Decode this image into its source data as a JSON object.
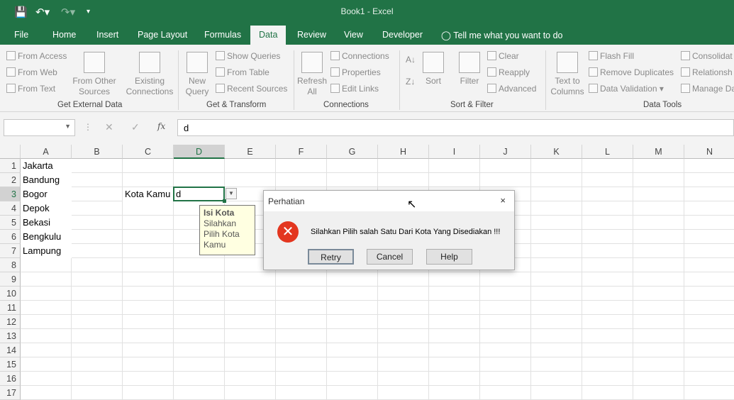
{
  "window": {
    "title": "Book1  -  Excel"
  },
  "tabs": [
    "File",
    "Home",
    "Insert",
    "Page Layout",
    "Formulas",
    "Data",
    "Review",
    "View",
    "Developer"
  ],
  "tell_me": "Tell me what you want to do",
  "ribbon": {
    "get_external": {
      "label": "Get External Data",
      "from_access": "From Access",
      "from_web": "From Web",
      "from_text": "From Text",
      "from_other_1": "From Other",
      "from_other_2": "Sources",
      "existing_1": "Existing",
      "existing_2": "Connections"
    },
    "get_transform": {
      "label": "Get & Transform",
      "new_1": "New",
      "new_2": "Query",
      "show_queries": "Show Queries",
      "from_table": "From Table",
      "recent_sources": "Recent Sources"
    },
    "connections": {
      "label": "Connections",
      "refresh_1": "Refresh",
      "refresh_2": "All",
      "connections": "Connections",
      "properties": "Properties",
      "edit_links": "Edit Links"
    },
    "sort_filter": {
      "label": "Sort & Filter",
      "sort": "Sort",
      "filter": "Filter",
      "clear": "Clear",
      "reapply": "Reapply",
      "advanced": "Advanced"
    },
    "data_tools": {
      "label": "Data Tools",
      "text_to_1": "Text to",
      "text_to_2": "Columns",
      "flash_fill": "Flash Fill",
      "remove_duplicates": "Remove Duplicates",
      "data_validation": "Data Validation",
      "consolidate": "Consolidat",
      "relationships": "Relationsh",
      "manage": "Manage Da"
    }
  },
  "formula_bar": {
    "name_box": "",
    "value": "d"
  },
  "columns": [
    "A",
    "B",
    "C",
    "D",
    "E",
    "F",
    "G",
    "H",
    "I",
    "J",
    "K",
    "L",
    "M",
    "N"
  ],
  "rows": [
    "1",
    "2",
    "3",
    "4",
    "5",
    "6",
    "7",
    "8",
    "9",
    "10",
    "11",
    "12",
    "13",
    "14",
    "15",
    "16",
    "17"
  ],
  "cells": {
    "A": [
      "Jakarta",
      "Bandung",
      "Bogor",
      "Depok",
      "Bekasi",
      "Bengkulu",
      "Lampung"
    ],
    "C3": "Kota Kamu",
    "D3": "d"
  },
  "input_message": {
    "title": "Isi Kota",
    "l1": "Silahkan",
    "l2": "Pilih Kota",
    "l3": "Kamu"
  },
  "dialog": {
    "title": "Perhatian",
    "message": "Silahkan Pilih salah Satu Dari Kota Yang Disediakan !!!",
    "retry": "Retry",
    "cancel": "Cancel",
    "help": "Help"
  }
}
